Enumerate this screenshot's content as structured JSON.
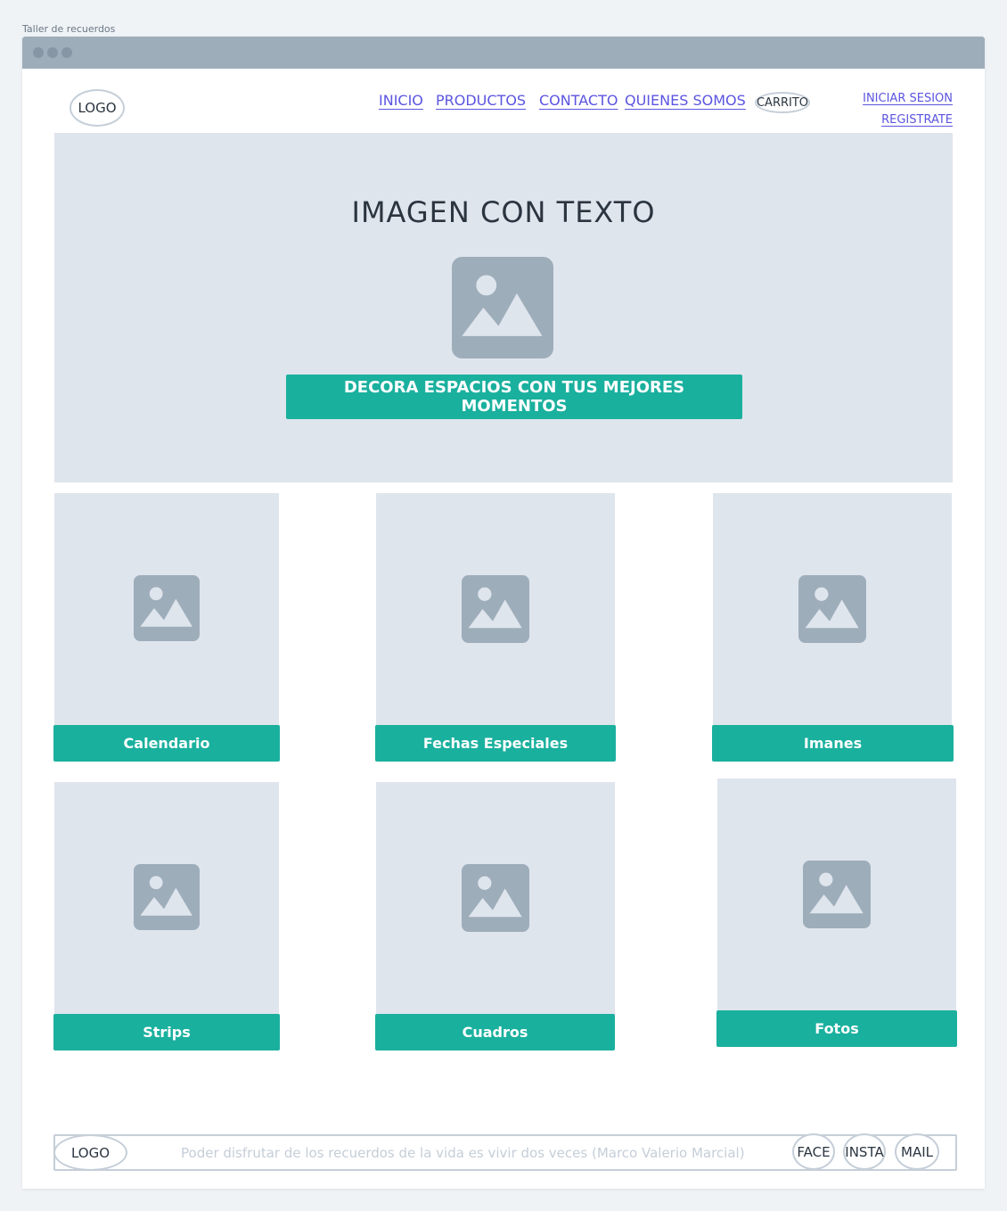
{
  "page_label": "Taller de recuerdos",
  "header": {
    "logo": "LOGO",
    "nav": [
      "INICIO",
      "PRODUCTOS",
      "CONTACTO",
      "QUIENES SOMOS"
    ],
    "cart": "CARRITO",
    "login": "INICIAR SESION",
    "register": "REGISTRATE"
  },
  "hero": {
    "title": "IMAGEN CON TEXTO",
    "cta": "DECORA ESPACIOS CON TUS MEJORES MOMENTOS"
  },
  "products": [
    "Calendario",
    "Fechas Especiales",
    "Imanes",
    "Strips",
    "Cuadros",
    "Fotos"
  ],
  "footer": {
    "logo": "LOGO",
    "quote": "Poder disfrutar de los recuerdos de la vida es vivir dos veces (Marco Valerio Marcial)",
    "social": [
      "FACE",
      "INSTA",
      "MAIL"
    ]
  },
  "colors": {
    "accent": "#1ab09e",
    "link": "#5b54e0",
    "placeholder_bg": "#dfe5ed",
    "icon": "#9eadba"
  },
  "icons": [
    "image-placeholder-icon"
  ]
}
